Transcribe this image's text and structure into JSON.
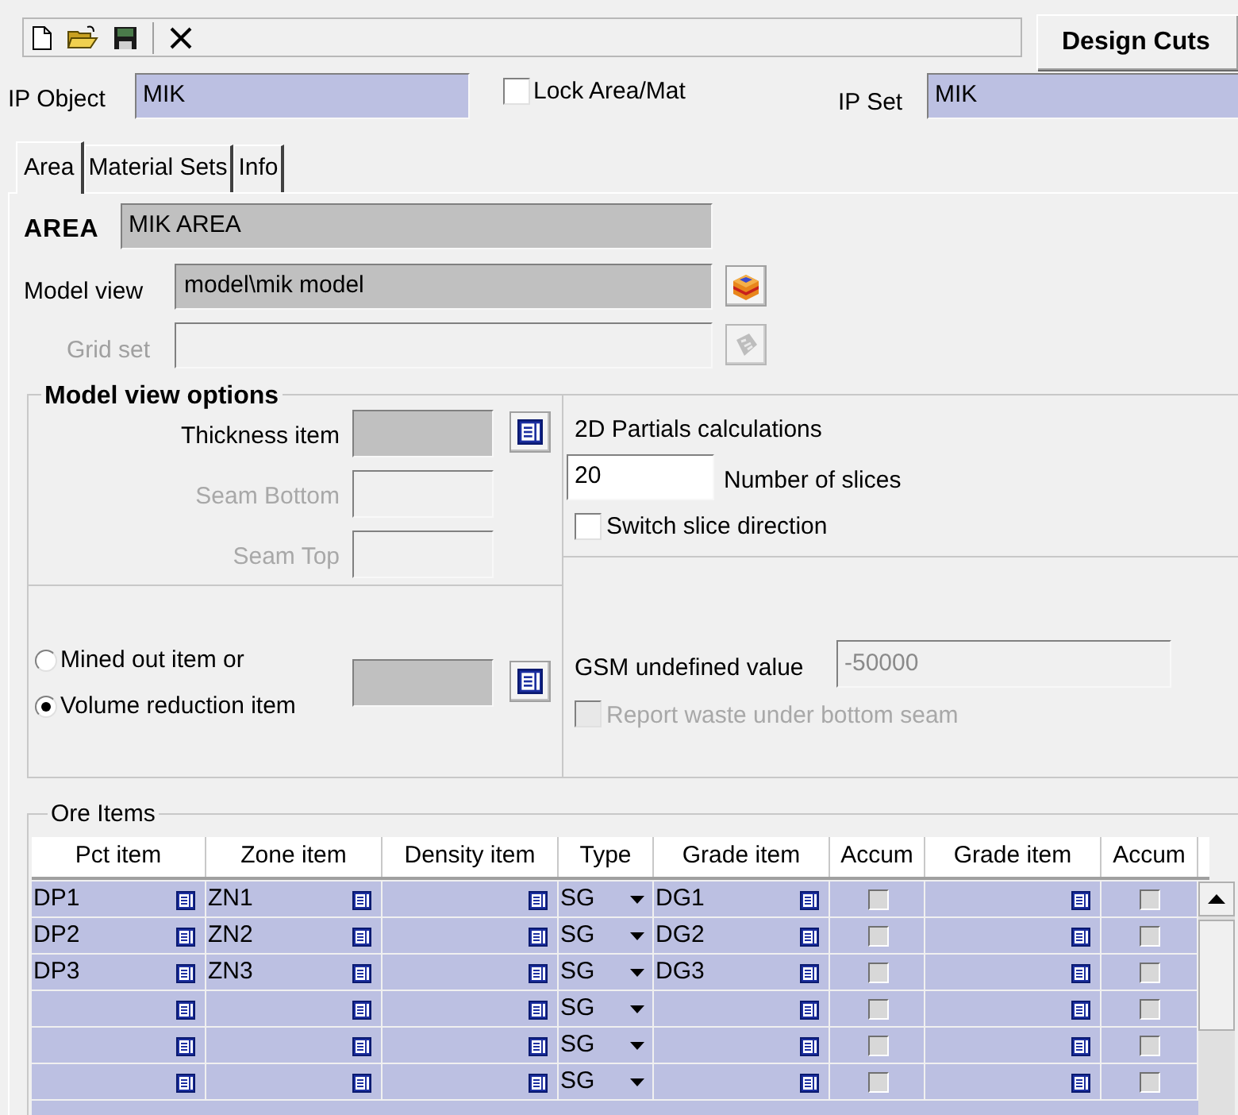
{
  "design_cuts_button": "Design Cuts",
  "ip_object": {
    "label": "IP Object",
    "value": "MIK"
  },
  "lock_area_mat": {
    "label": "Lock Area/Mat",
    "checked": false
  },
  "ip_set": {
    "label": "IP Set",
    "value": "MIK"
  },
  "tabs": [
    {
      "label": "Area",
      "selected": true
    },
    {
      "label": "Material Sets",
      "selected": false
    },
    {
      "label": "Info",
      "selected": false
    }
  ],
  "area": {
    "label": "AREA",
    "value": "MIK AREA"
  },
  "model_view": {
    "label": "Model view",
    "value": "model\\mik model"
  },
  "grid_set": {
    "label": "Grid set",
    "disabled": true
  },
  "model_view_options": {
    "title": "Model view options",
    "fields": [
      {
        "label": "Thickness item",
        "disabled": false
      },
      {
        "label": "Seam Bottom",
        "disabled": true
      },
      {
        "label": "Seam Top",
        "disabled": true
      }
    ],
    "partials": {
      "title": "2D Partials calculations",
      "slices_value": "20",
      "slices_label": "Number of slices",
      "switch": {
        "label": "Switch slice direction",
        "checked": false
      }
    },
    "reduction_options": [
      {
        "label": "Mined out item or",
        "selected": false
      },
      {
        "label": "Volume reduction item",
        "selected": true
      }
    ],
    "gsm": {
      "label": "GSM undefined value",
      "value": "-50000"
    },
    "report_waste": {
      "label": "Report waste under bottom seam",
      "checked": false,
      "disabled": true
    }
  },
  "ore_items": {
    "title": "Ore Items",
    "columns": [
      "Pct item",
      "Zone item",
      "Density item",
      "Type",
      "Grade item",
      "Accum",
      "Grade item",
      "Accum"
    ],
    "rows": [
      {
        "pct": "DP1",
        "zone": "ZN1",
        "type": "SG",
        "grade_1": "DG1",
        "accum_1": false,
        "accum_2": false
      },
      {
        "pct": "DP2",
        "zone": "ZN2",
        "type": "SG",
        "grade_1": "DG2",
        "accum_1": false,
        "accum_2": false
      },
      {
        "pct": "DP3",
        "zone": "ZN3",
        "type": "SG",
        "grade_1": "DG3",
        "accum_1": false,
        "accum_2": false
      },
      {
        "type": "SG",
        "accum_1": false,
        "accum_2": false
      },
      {
        "type": "SG",
        "accum_1": false,
        "accum_2": false
      },
      {
        "type": "SG",
        "accum_1": false,
        "accum_2": false
      }
    ]
  }
}
